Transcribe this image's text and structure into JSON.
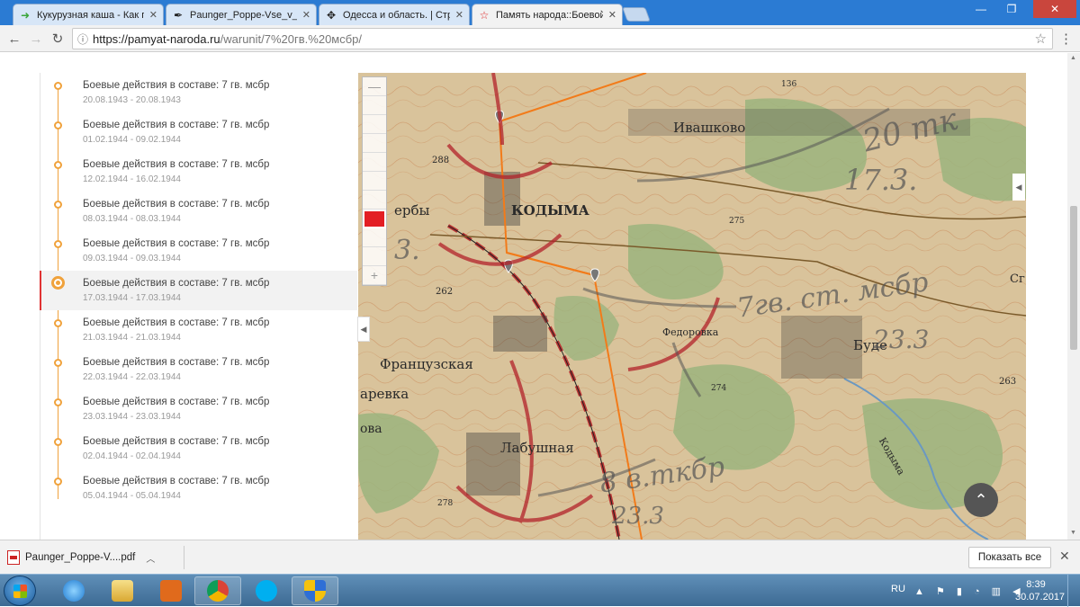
{
  "browser": {
    "tabs": [
      {
        "title": "Кукурузная каша - Как п",
        "icon": "green-arrow-icon"
      },
      {
        "title": "Paunger_Poppe-Vse_v_n",
        "icon": "feather-icon"
      },
      {
        "title": "Одесса и область. | Стра",
        "icon": "compass-icon"
      },
      {
        "title": "Память народа::Боевой",
        "icon": "red-star-icon",
        "active": true
      }
    ],
    "url_host": "https://pamyat-naroda.ru",
    "url_path": "/warunit/7%20гв.%20мсбр/"
  },
  "timeline": {
    "entries": [
      {
        "title": "Боевые действия в составе: 7 гв. мсбр",
        "dates": "20.08.1943 - 20.08.1943"
      },
      {
        "title": "Боевые действия в составе: 7 гв. мсбр",
        "dates": "01.02.1944 - 09.02.1944"
      },
      {
        "title": "Боевые действия в составе: 7 гв. мсбр",
        "dates": "12.02.1944 - 16.02.1944"
      },
      {
        "title": "Боевые действия в составе: 7 гв. мсбр",
        "dates": "08.03.1944 - 08.03.1944"
      },
      {
        "title": "Боевые действия в составе: 7 гв. мсбр",
        "dates": "09.03.1944 - 09.03.1944"
      },
      {
        "title": "Боевые действия в составе: 7 гв. мсбр",
        "dates": "17.03.1944 - 17.03.1944",
        "active": true
      },
      {
        "title": "Боевые действия в составе: 7 гв. мсбр",
        "dates": "21.03.1944 - 21.03.1944"
      },
      {
        "title": "Боевые действия в составе: 7 гв. мсбр",
        "dates": "22.03.1944 - 22.03.1944"
      },
      {
        "title": "Боевые действия в составе: 7 гв. мсбр",
        "dates": "23.03.1944 - 23.03.1944"
      },
      {
        "title": "Боевые действия в составе: 7 гв. мсбр",
        "dates": "02.04.1944 - 02.04.1944"
      },
      {
        "title": "Боевые действия в составе: 7 гв. мсбр",
        "dates": "05.04.1944 - 05.04.1944"
      }
    ]
  },
  "map": {
    "places": [
      "Ивашково",
      "КОДЫМА",
      "ербы",
      "Французская",
      "аревка",
      "Лабушная",
      "Федоровка",
      "Буде",
      "Кодыма",
      "ова",
      "Сг"
    ],
    "elevations": [
      "288",
      "275",
      "262",
      "274",
      "263",
      "278",
      "136"
    ],
    "annotations": [
      "20 тк",
      "17.3.",
      "7гв. ст. мсбр",
      "23.3",
      "8 в.ткбр",
      "23.3",
      "3."
    ],
    "zoom_levels": 10,
    "zoom_selected": 8
  },
  "downloads": {
    "file": "Paunger_Poppe-V....pdf",
    "show_all": "Показать все"
  },
  "taskbar": {
    "lang": "RU",
    "time": "8:39",
    "date": "30.07.2017"
  }
}
